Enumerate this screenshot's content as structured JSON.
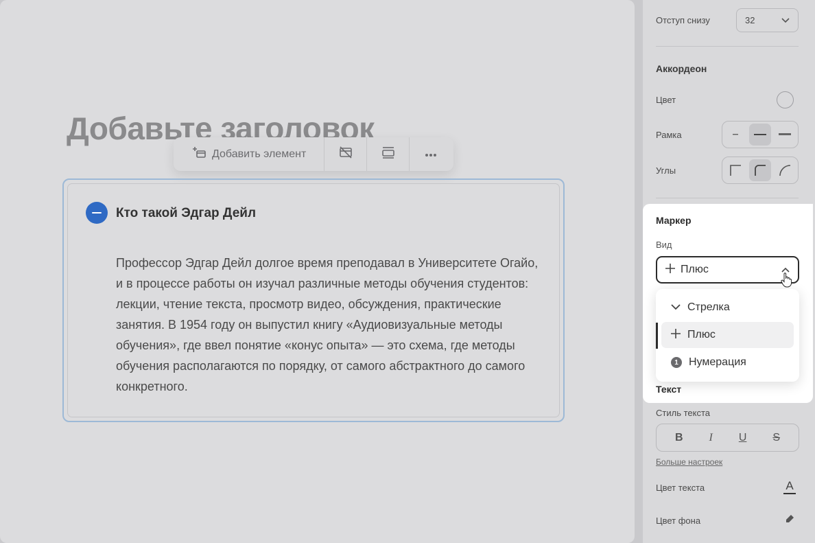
{
  "canvas": {
    "heading_placeholder": "Добавьте заголовок",
    "toolbar": {
      "add_element_label": "Добавить элемент",
      "icons": [
        "add-element-icon",
        "hide-card-icon",
        "layout-icon",
        "more-icon"
      ]
    },
    "accordion": {
      "title": "Кто такой Эдгар Дейл",
      "body": "Профессор Эдгар Дейл долгое время преподавал в Университете Огайо, и в процессе работы он изучал различные методы обучения студентов: лекции, чтение текста, просмотр видео, обсуждения, практические занятия. В 1954 году он выпустил книгу «Аудиовизуальные методы обучения», где ввел понятие «конус опыта» — это схема, где методы обучения располагаются по порядку, от самого абстрактного до самого конкретного.",
      "marker_color": "#2f6ac4"
    }
  },
  "panel": {
    "padding_bottom": {
      "label": "Отступ снизу",
      "value": "32"
    },
    "accordion_section": {
      "title": "Аккордеон",
      "color_label": "Цвет",
      "border_label": "Рамка",
      "border_options": [
        "-",
        "—",
        "—"
      ],
      "corners_label": "Углы"
    },
    "marker": {
      "title": "Маркер",
      "kind_label": "Вид",
      "selected": "Плюс",
      "options": [
        {
          "label": "Стрелка",
          "icon": "chevron-down-icon"
        },
        {
          "label": "Плюс",
          "icon": "plus-icon"
        },
        {
          "label": "Нумерация",
          "icon": "number-badge-icon",
          "badge": "1"
        }
      ]
    },
    "text": {
      "title": "Текст",
      "style_label": "Стиль текста",
      "style_buttons": [
        "B",
        "I",
        "U",
        "S"
      ],
      "more_settings": "Больше настроек",
      "text_color_label": "Цвет текста",
      "text_color_glyph": "A",
      "bg_color_label": "Цвет фона"
    }
  }
}
